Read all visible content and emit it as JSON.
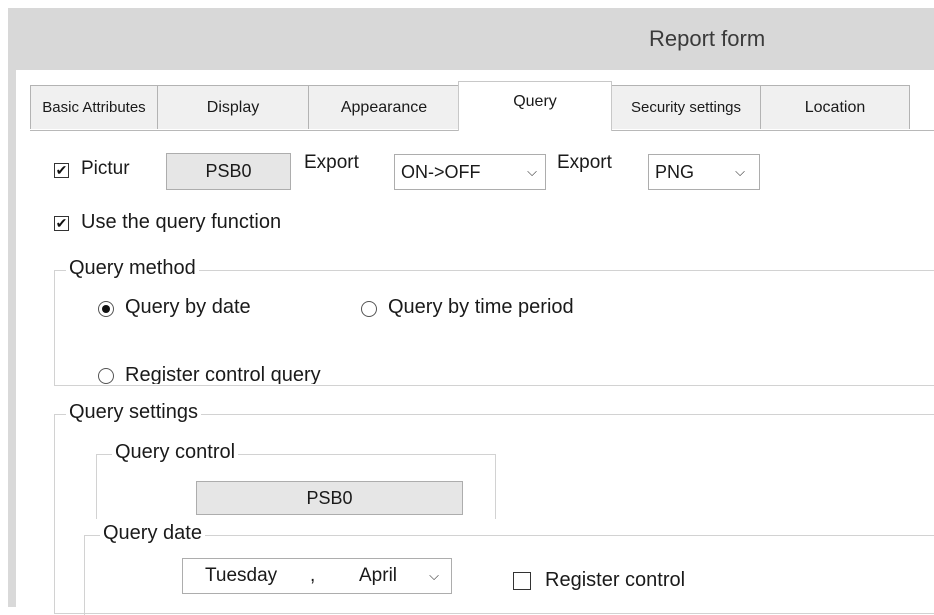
{
  "window": {
    "title": "Report form"
  },
  "tabs": [
    {
      "label": "Basic Attributes",
      "active": false
    },
    {
      "label": "Display",
      "active": false
    },
    {
      "label": "Appearance",
      "active": false
    },
    {
      "label": "Query",
      "active": true
    },
    {
      "label": "Security settings",
      "active": false
    },
    {
      "label": "Location",
      "active": false
    }
  ],
  "export_row": {
    "picture_checkbox": {
      "label": "Pictur",
      "checked": true
    },
    "picture_field": "PSB0",
    "export_label_1": "Export",
    "trigger_select": "ON->OFF",
    "export_label_2": "Export",
    "format_select": "PNG"
  },
  "use_query": {
    "label": "Use the query function",
    "checked": true
  },
  "query_method": {
    "title": "Query method",
    "options": [
      {
        "label": "Query by date",
        "selected": true
      },
      {
        "label": "Query by time period",
        "selected": false
      },
      {
        "label": "Register control query",
        "selected": false
      }
    ]
  },
  "query_settings": {
    "title": "Query settings",
    "query_control": {
      "title": "Query control",
      "value": "PSB0"
    },
    "query_date": {
      "title": "Query date",
      "day": "Tuesday",
      "separator": ",",
      "month": "April",
      "register_control": {
        "label": "Register control",
        "checked": false
      }
    }
  },
  "icons": {
    "check": "✔",
    "caret": "chevron-down-icon"
  }
}
